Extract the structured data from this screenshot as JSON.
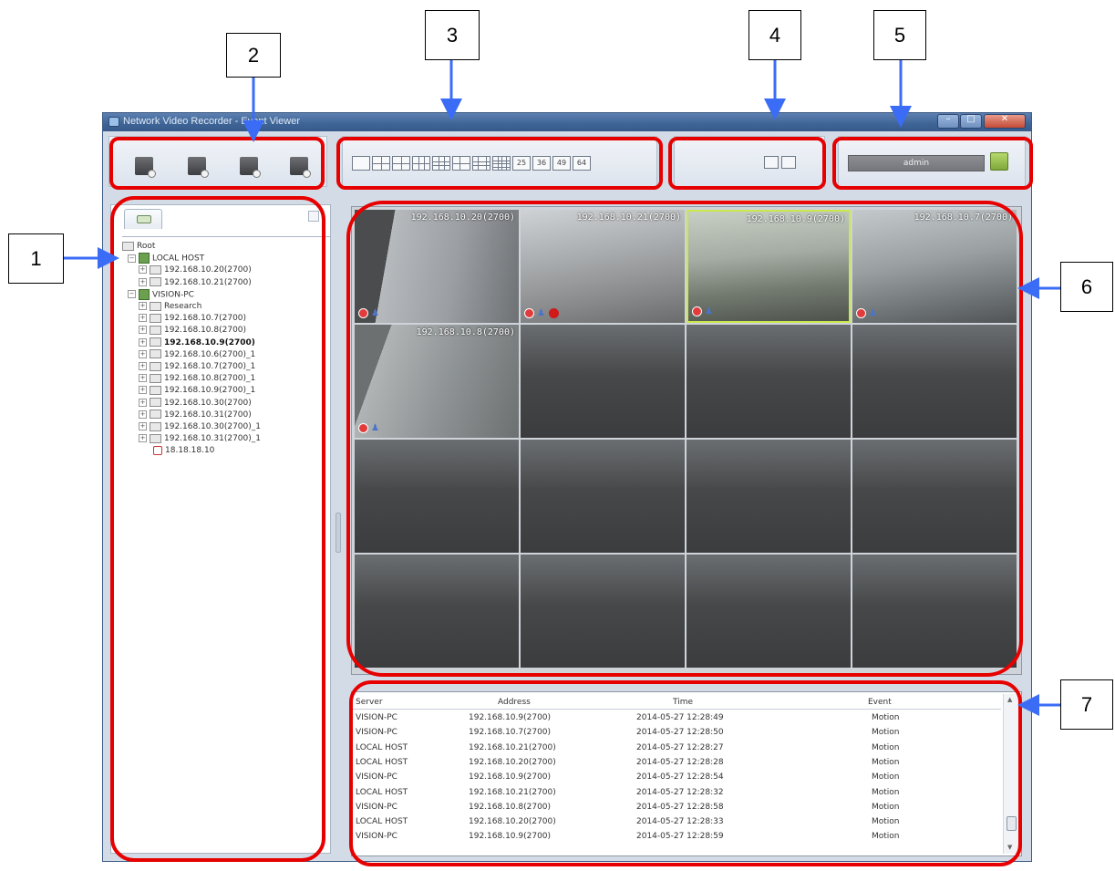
{
  "window": {
    "title": "Network Video Recorder - Event Viewer"
  },
  "callouts": [
    "1",
    "2",
    "3",
    "4",
    "5",
    "6",
    "7"
  ],
  "toolbar": {
    "tool_buttons": [
      "camera-add-icon",
      "camera-view-icon",
      "camera-settings-icon",
      "camera-time-icon"
    ],
    "layouts": [
      "1",
      "4",
      "6",
      "8",
      "9",
      "10",
      "13",
      "16",
      "25",
      "36",
      "49",
      "64"
    ],
    "layout_labels": {
      "25": "25",
      "36": "36",
      "49": "49",
      "64": "64"
    },
    "user": "admin"
  },
  "tree": {
    "tab_icon": "camera-tab-icon",
    "nodes": [
      {
        "label": "Root",
        "type": "root"
      },
      {
        "label": "LOCAL HOST",
        "type": "server"
      },
      {
        "label": "192.168.10.20(2700)",
        "type": "camera"
      },
      {
        "label": "192.168.10.21(2700)",
        "type": "camera"
      },
      {
        "label": "VISION-PC",
        "type": "server"
      },
      {
        "label": "Research",
        "type": "group"
      },
      {
        "label": "192.168.10.7(2700)",
        "type": "camera"
      },
      {
        "label": "192.168.10.8(2700)",
        "type": "camera"
      },
      {
        "label": "192.168.10.9(2700)",
        "type": "camera",
        "bold": true
      },
      {
        "label": "192.168.10.6(2700)_1",
        "type": "camera"
      },
      {
        "label": "192.168.10.7(2700)_1",
        "type": "camera"
      },
      {
        "label": "192.168.10.8(2700)_1",
        "type": "camera"
      },
      {
        "label": "192.168.10.9(2700)_1",
        "type": "camera"
      },
      {
        "label": "192.168.10.30(2700)",
        "type": "camera"
      },
      {
        "label": "192.168.10.31(2700)",
        "type": "camera"
      },
      {
        "label": "192.168.10.30(2700)_1",
        "type": "camera"
      },
      {
        "label": "192.168.10.31(2700)_1",
        "type": "camera"
      },
      {
        "label": "18.18.18.10",
        "type": "disconnected"
      }
    ]
  },
  "grid": {
    "cameras": [
      {
        "label": "192.168.10.20(2700)",
        "alarm": false,
        "selected": false
      },
      {
        "label": "192.168.10.21(2700)",
        "alarm": true,
        "selected": false
      },
      {
        "label": "192.168.10.9(2700)",
        "alarm": false,
        "selected": true
      },
      {
        "label": "192.168.10.7(2700)",
        "alarm": false,
        "selected": false
      },
      {
        "label": "192.168.10.8(2700)",
        "alarm": false,
        "selected": false
      }
    ]
  },
  "events": {
    "headers": {
      "server": "Server",
      "address": "Address",
      "time": "Time",
      "event": "Event"
    },
    "rows": [
      {
        "server": "VISION-PC",
        "address": "192.168.10.9(2700)",
        "time": "2014-05-27 12:28:49",
        "event": "Motion"
      },
      {
        "server": "VISION-PC",
        "address": "192.168.10.7(2700)",
        "time": "2014-05-27 12:28:50",
        "event": "Motion"
      },
      {
        "server": "LOCAL HOST",
        "address": "192.168.10.21(2700)",
        "time": "2014-05-27 12:28:27",
        "event": "Motion"
      },
      {
        "server": "LOCAL HOST",
        "address": "192.168.10.20(2700)",
        "time": "2014-05-27 12:28:28",
        "event": "Motion"
      },
      {
        "server": "VISION-PC",
        "address": "192.168.10.9(2700)",
        "time": "2014-05-27 12:28:54",
        "event": "Motion"
      },
      {
        "server": "LOCAL HOST",
        "address": "192.168.10.21(2700)",
        "time": "2014-05-27 12:28:32",
        "event": "Motion"
      },
      {
        "server": "VISION-PC",
        "address": "192.168.10.8(2700)",
        "time": "2014-05-27 12:28:58",
        "event": "Motion"
      },
      {
        "server": "LOCAL HOST",
        "address": "192.168.10.20(2700)",
        "time": "2014-05-27 12:28:33",
        "event": "Motion"
      },
      {
        "server": "VISION-PC",
        "address": "192.168.10.9(2700)",
        "time": "2014-05-27 12:28:59",
        "event": "Motion"
      }
    ]
  },
  "colors": {
    "highlight_ring": "#e60000",
    "arrow": "#3b6cf6",
    "selected_cell": "#c9e84e"
  }
}
